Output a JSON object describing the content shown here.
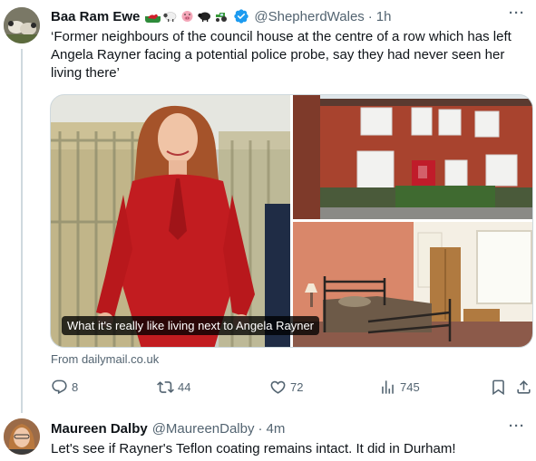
{
  "tweet1": {
    "name": "Baa Ram Ewe",
    "emoji_icons": [
      "wales-flag-icon",
      "sheep-icon",
      "pig-icon",
      "black-sheep-icon",
      "tractor-icon"
    ],
    "handle": "@ShepherdWales",
    "separator": "·",
    "time": "1h",
    "more": "···",
    "text": "‘Former neighbours of the council house at the centre of a row which has left Angela Rayner facing a potential police probe, say they had never seen her living there’",
    "media": {
      "caption": "What it's really like living next to Angela Rayner"
    },
    "source": "From dailymail.co.uk",
    "actions": {
      "replies": "8",
      "retweets": "44",
      "likes": "72",
      "views": "745"
    }
  },
  "tweet2": {
    "name": "Maureen Dalby",
    "handle": "@MaureenDalby",
    "separator": "·",
    "time": "4m",
    "more": "···",
    "text": "Let's see if Rayner's Teflon coating remains intact. It did in Durham!"
  },
  "colors": {
    "text": "#0f1419",
    "secondary": "#536471",
    "verified": "#1d9bf0",
    "border": "#cfd9de"
  }
}
